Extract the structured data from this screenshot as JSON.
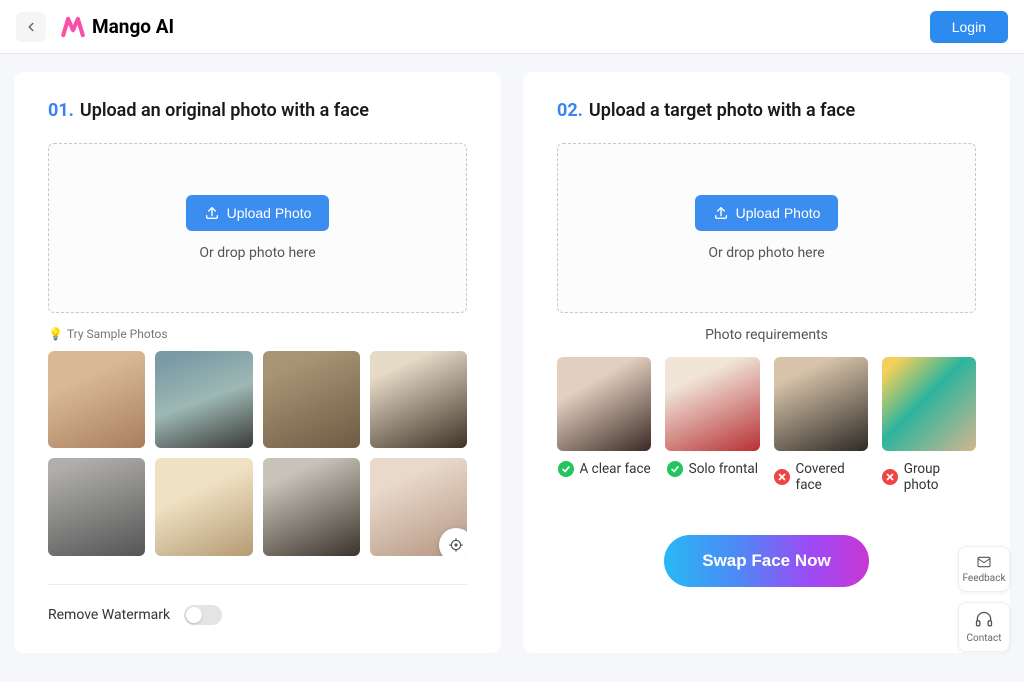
{
  "header": {
    "brand": "Mango AI",
    "login": "Login"
  },
  "step1": {
    "num": "01.",
    "title": "Upload an original photo with a face",
    "upload_btn": "Upload Photo",
    "drop_text": "Or drop photo here",
    "sample_label": "Try Sample Photos",
    "watermark_label": "Remove Watermark"
  },
  "step2": {
    "num": "02.",
    "title": "Upload a target photo with a face",
    "upload_btn": "Upload Photo",
    "drop_text": "Or drop photo here",
    "req_title": "Photo requirements",
    "requirements": {
      "r1": {
        "label": "A clear face",
        "ok": true
      },
      "r2": {
        "label": "Solo frontal",
        "ok": true
      },
      "r3": {
        "label": "Covered face",
        "ok": false
      },
      "r4": {
        "label": "Group photo",
        "ok": false
      }
    },
    "swap_btn": "Swap Face Now"
  },
  "fab": {
    "feedback": "Feedback",
    "contact": "Contact"
  }
}
